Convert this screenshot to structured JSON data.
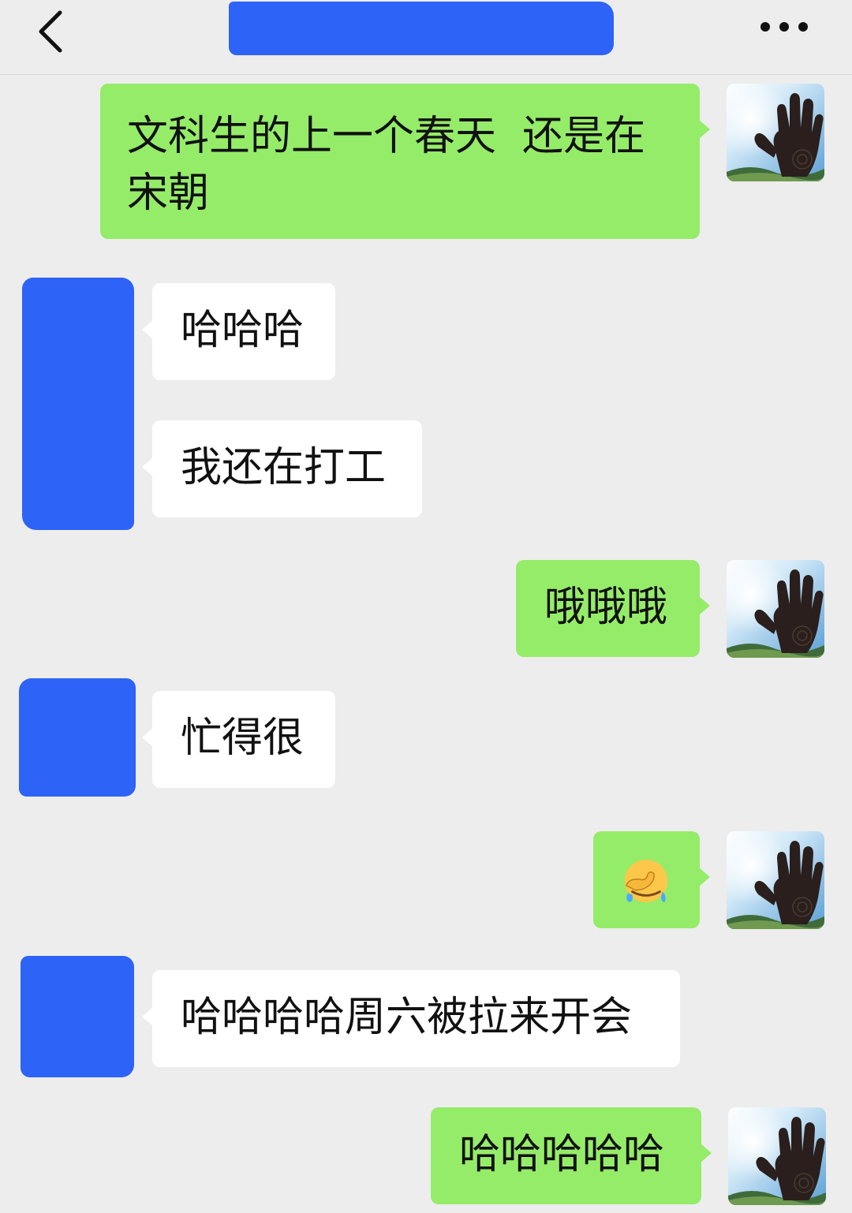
{
  "header": {
    "back_icon": "chevron-left-icon",
    "title_redacted": true,
    "more_icon": "more-horizontal-icon"
  },
  "messages": [
    {
      "from": "self",
      "text": "文科生的上一个春天  还是在宋朝"
    },
    {
      "from": "other",
      "text": "哈哈哈"
    },
    {
      "from": "other",
      "text": "我还在打工"
    },
    {
      "from": "self",
      "text": "哦哦哦"
    },
    {
      "from": "other",
      "text": "忙得很"
    },
    {
      "from": "self",
      "emoji": "facepalm-cry-emoji"
    },
    {
      "from": "other",
      "text": "哈哈哈哈周六被拉来开会"
    },
    {
      "from": "self",
      "text": "哈哈哈哈哈"
    }
  ],
  "colors": {
    "background": "#ededed",
    "self_bubble": "#95ec69",
    "other_bubble": "#ffffff",
    "redaction": "#2d63f6"
  }
}
